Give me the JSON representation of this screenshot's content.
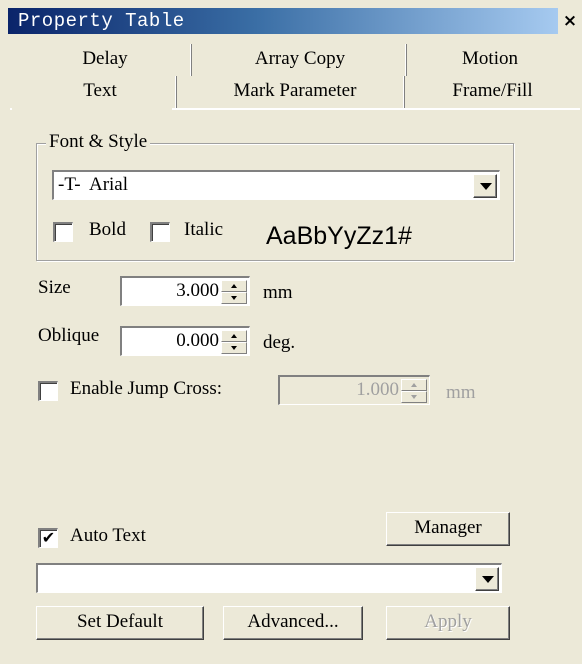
{
  "window": {
    "title": "Property Table",
    "close_glyph": "×"
  },
  "tabs": {
    "row1": [
      "Delay",
      "Array Copy",
      "Motion"
    ],
    "row2": [
      "Text",
      "Mark Parameter",
      "Frame/Fill"
    ],
    "active": "Text"
  },
  "font_style": {
    "legend": "Font & Style",
    "font_value": "-T-  Arial",
    "bold_label": "Bold",
    "bold_checked": false,
    "italic_label": "Italic",
    "italic_checked": false,
    "preview_text": "AaBbYyZz1#"
  },
  "size": {
    "label": "Size",
    "value": "3.000",
    "unit": "mm"
  },
  "oblique": {
    "label": "Oblique",
    "value": "0.000",
    "unit": "deg."
  },
  "jump_cross": {
    "label": "Enable Jump Cross:",
    "checked": false,
    "value": "1.000",
    "unit": "mm"
  },
  "auto_text": {
    "label": "Auto Text",
    "checked": true,
    "check_glyph": "✔",
    "manager_label": "Manager",
    "combo_value": ""
  },
  "buttons": {
    "set_default": "Set Default",
    "advanced": "Advanced...",
    "apply": "Apply"
  },
  "colors": {
    "title_bar_start": "#0a246a",
    "title_bar_end": "#a6caf0",
    "face": "#ece9d8",
    "disabled_text": "#a0a0a0"
  }
}
